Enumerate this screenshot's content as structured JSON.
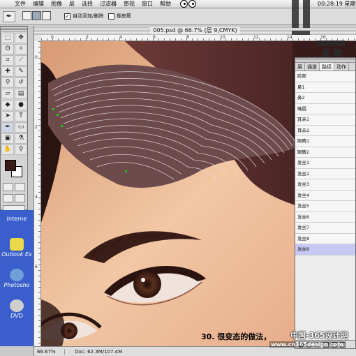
{
  "menubar": {
    "items": [
      "文件",
      "编辑",
      "图像",
      "层",
      "选择",
      "过滤器",
      "审视",
      "窗口",
      "帮助"
    ],
    "clock": "00:28:19 星期"
  },
  "options": {
    "auto_add_delete": "自动添加/删除",
    "rubber_band": "橡皮筋"
  },
  "document": {
    "title": "005.psd @ 66.7% (层 9,CMYK)",
    "zoom": "66.67%",
    "doc_size": "Doc: 62.3M/107.4M",
    "ruler_marks": [
      "0",
      "2",
      "4",
      "6",
      "8",
      "10",
      "12",
      "14",
      "16",
      "18"
    ],
    "vruler_marks": [
      "0",
      "2",
      "4",
      "6"
    ]
  },
  "layers": {
    "tabs": [
      "层",
      "通道",
      "路径",
      "动作"
    ],
    "items": [
      "脸部",
      "鼻1",
      "鼻2",
      "嘴唇",
      "耳朵1",
      "耳朵2",
      "眼睛1",
      "眼睛2",
      "发丝1",
      "发丝2",
      "发丝3",
      "发丝4",
      "发丝5",
      "发丝6",
      "发丝7",
      "发丝8",
      "发丝9"
    ],
    "selected": "发丝9"
  },
  "desktop": {
    "internet": "Interne",
    "outlook": "Outlook Ex",
    "photoshop": "Photosho",
    "dvd": "DVD"
  },
  "overlay": {
    "caption": "30. 很变态的做法，",
    "site_cn": "中国-365设计网",
    "site_url": "www.cn365design.com"
  },
  "colors": {
    "foreground": "#3b1d18",
    "background": "#ffffff",
    "desktop": "#3a5fcd"
  }
}
